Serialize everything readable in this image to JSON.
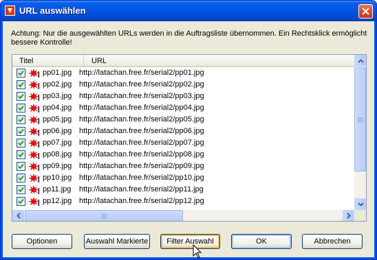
{
  "window": {
    "title": "URL auswählen"
  },
  "info_text": "Achtung: Nur die ausgewählten URLs werden in die Auftragsliste übernommen. Ein Rechtsklick ermöglicht bessere Kontrolle!",
  "columns": {
    "title": "Titel",
    "url": "URL"
  },
  "rows": [
    {
      "title": "pp01.jpg",
      "url": "http://latachan.free.fr/serial2/pp01.jpg",
      "checked": true
    },
    {
      "title": "pp02.jpg",
      "url": "http://latachan.free.fr/serial2/pp02.jpg",
      "checked": true
    },
    {
      "title": "pp03.jpg",
      "url": "http://latachan.free.fr/serial2/pp03.jpg",
      "checked": true
    },
    {
      "title": "pp04.jpg",
      "url": "http://latachan.free.fr/serial2/pp04.jpg",
      "checked": true
    },
    {
      "title": "pp05.jpg",
      "url": "http://latachan.free.fr/serial2/pp05.jpg",
      "checked": true
    },
    {
      "title": "pp06.jpg",
      "url": "http://latachan.free.fr/serial2/pp06.jpg",
      "checked": true
    },
    {
      "title": "pp07.jpg",
      "url": "http://latachan.free.fr/serial2/pp07.jpg",
      "checked": true
    },
    {
      "title": "pp08.jpg",
      "url": "http://latachan.free.fr/serial2/pp08.jpg",
      "checked": true
    },
    {
      "title": "pp09.jpg",
      "url": "http://latachan.free.fr/serial2/pp09.jpg",
      "checked": true
    },
    {
      "title": "pp10.jpg",
      "url": "http://latachan.free.fr/serial2/pp10.jpg",
      "checked": true
    },
    {
      "title": "pp11.jpg",
      "url": "http://latachan.free.fr/serial2/pp11.jpg",
      "checked": true
    },
    {
      "title": "pp12.jpg",
      "url": "http://latachan.free.fr/serial2/pp12.jpg",
      "checked": true
    }
  ],
  "buttons": {
    "options": "Optionen",
    "select_marked": "Auswahl Markierte",
    "filter": "Filter Auswahl",
    "ok": "OK",
    "cancel": "Abbrechen"
  },
  "icons": {
    "app": "app-icon",
    "close": "close-icon",
    "row": "red-splat-icon",
    "checkbox": "checkmark-icon"
  },
  "colors": {
    "title_bar": "#0054e3",
    "dialog_bg": "#ece9d8",
    "check_green": "#21a121",
    "row_icon_red": "#e0101a"
  }
}
